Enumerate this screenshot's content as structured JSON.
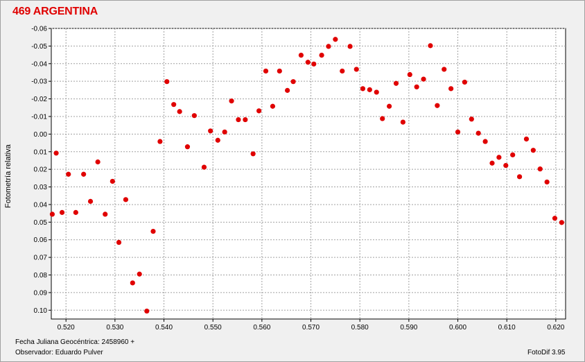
{
  "chart_data": {
    "type": "scatter",
    "title": "469 ARGENTINA",
    "ylabel": "Fotometría relativa",
    "xlim": [
      0.517,
      0.622
    ],
    "ylim": [
      -0.06,
      0.105
    ],
    "y_inverted": true,
    "grid": true,
    "xticks": [
      "0.520",
      "0.530",
      "0.540",
      "0.550",
      "0.560",
      "0.570",
      "0.580",
      "0.590",
      "0.600",
      "0.610",
      "0.620"
    ],
    "yticks": [
      "-0.06",
      "-0.05",
      "-0.04",
      "-0.03",
      "-0.02",
      "-0.01",
      "0.00",
      "0.01",
      "0.02",
      "0.03",
      "0.04",
      "0.05",
      "0.06",
      "0.07",
      "0.08",
      "0.09",
      "0.10"
    ],
    "point_color": "#e00000",
    "points": [
      [
        0.5172,
        0.0455
      ],
      [
        0.518,
        0.0108
      ],
      [
        0.5192,
        0.0445
      ],
      [
        0.5205,
        0.0228
      ],
      [
        0.522,
        0.0445
      ],
      [
        0.5236,
        0.0228
      ],
      [
        0.525,
        0.0382
      ],
      [
        0.5265,
        0.0158
      ],
      [
        0.528,
        0.0455
      ],
      [
        0.5295,
        0.0268
      ],
      [
        0.5308,
        0.0615
      ],
      [
        0.5322,
        0.0372
      ],
      [
        0.5336,
        0.0845
      ],
      [
        0.535,
        0.0795
      ],
      [
        0.5365,
        0.1005
      ],
      [
        0.5378,
        0.0552
      ],
      [
        0.5392,
        0.0042
      ],
      [
        0.5406,
        -0.0298
      ],
      [
        0.542,
        -0.0168
      ],
      [
        0.5432,
        -0.0128
      ],
      [
        0.5448,
        0.0072
      ],
      [
        0.5462,
        -0.0105
      ],
      [
        0.5482,
        0.0188
      ],
      [
        0.5495,
        -0.0018
      ],
      [
        0.551,
        0.0035
      ],
      [
        0.5524,
        -0.0012
      ],
      [
        0.5538,
        -0.0188
      ],
      [
        0.5552,
        -0.0082
      ],
      [
        0.5566,
        -0.0082
      ],
      [
        0.5582,
        0.0112
      ],
      [
        0.5594,
        -0.0132
      ],
      [
        0.5608,
        -0.0358
      ],
      [
        0.5622,
        -0.0158
      ],
      [
        0.5636,
        -0.0358
      ],
      [
        0.5652,
        -0.0248
      ],
      [
        0.5664,
        -0.0298
      ],
      [
        0.568,
        -0.0448
      ],
      [
        0.5694,
        -0.0408
      ],
      [
        0.5706,
        -0.0398
      ],
      [
        0.5722,
        -0.0448
      ],
      [
        0.5736,
        -0.0498
      ],
      [
        0.575,
        -0.0538
      ],
      [
        0.5764,
        -0.0358
      ],
      [
        0.578,
        -0.0498
      ],
      [
        0.5793,
        -0.0368
      ],
      [
        0.5806,
        -0.0258
      ],
      [
        0.582,
        -0.0252
      ],
      [
        0.5834,
        -0.0238
      ],
      [
        0.5846,
        -0.0088
      ],
      [
        0.586,
        -0.0158
      ],
      [
        0.5874,
        -0.0288
      ],
      [
        0.5888,
        -0.0068
      ],
      [
        0.5902,
        -0.0338
      ],
      [
        0.5916,
        -0.0268
      ],
      [
        0.593,
        -0.0312
      ],
      [
        0.5944,
        -0.0502
      ],
      [
        0.5958,
        -0.0162
      ],
      [
        0.5972,
        -0.0368
      ],
      [
        0.5986,
        -0.0258
      ],
      [
        0.6,
        -0.0012
      ],
      [
        0.6014,
        -0.0295
      ],
      [
        0.6028,
        -0.0085
      ],
      [
        0.6042,
        -0.0005
      ],
      [
        0.6056,
        0.0042
      ],
      [
        0.607,
        0.0165
      ],
      [
        0.6084,
        0.0132
      ],
      [
        0.6098,
        0.0178
      ],
      [
        0.6112,
        0.0118
      ],
      [
        0.6126,
        0.0242
      ],
      [
        0.614,
        0.0028
      ],
      [
        0.6154,
        0.0092
      ],
      [
        0.6168,
        0.0198
      ],
      [
        0.6182,
        0.0272
      ],
      [
        0.6198,
        0.0478
      ],
      [
        0.6212,
        0.0502
      ]
    ]
  },
  "footer": {
    "date_label": "Fecha Juliana Geocéntrica: 2458960 +",
    "observer_label": "Observador: Eduardo Pulver",
    "software": "FotoDif 3.95"
  }
}
